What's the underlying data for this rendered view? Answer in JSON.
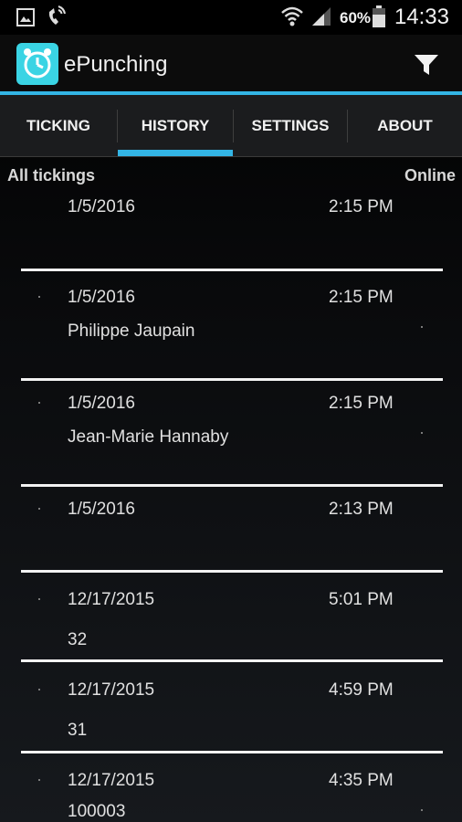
{
  "status_bar": {
    "battery_percent": "60%",
    "time": "14:33",
    "icons": [
      "gallery-icon",
      "phone-wifi-icon",
      "wifi-icon",
      "signal-icon",
      "battery-icon"
    ]
  },
  "action_bar": {
    "app_title": "ePunching",
    "app_icon": "clock-icon",
    "filter_icon": "filter-icon",
    "accent_color": "#33b5e5"
  },
  "tabs": [
    {
      "label": "TICKING"
    },
    {
      "label": "HISTORY",
      "selected": true
    },
    {
      "label": "SETTINGS"
    },
    {
      "label": "ABOUT"
    }
  ],
  "history": {
    "title": "All tickings",
    "mode": "Online",
    "entries": [
      {
        "date": "1/5/2016",
        "time": "2:15 PM",
        "name": ""
      },
      {
        "date": "1/5/2016",
        "time": "2:15 PM",
        "name": "Philippe Jaupain"
      },
      {
        "date": "1/5/2016",
        "time": "2:15 PM",
        "name": "Jean-Marie Hannaby"
      },
      {
        "date": "1/5/2016",
        "time": "2:13 PM",
        "name": ""
      },
      {
        "date": "12/17/2015",
        "time": "5:01 PM",
        "name": "32"
      },
      {
        "date": "12/17/2015",
        "time": "4:59 PM",
        "name": "31"
      },
      {
        "date": "12/17/2015",
        "time": "4:35 PM",
        "name": "100003"
      }
    ]
  }
}
